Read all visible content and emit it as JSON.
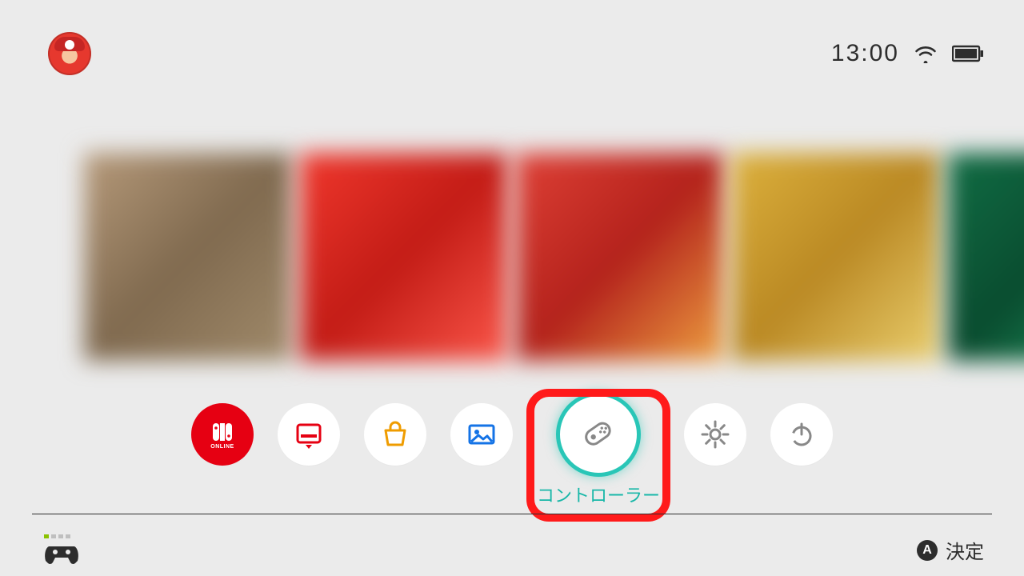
{
  "status": {
    "time": "13:00"
  },
  "dock": {
    "selected_index": 4,
    "items": [
      {
        "name": "online",
        "label": "オンライン"
      },
      {
        "name": "news",
        "label": "ニュース"
      },
      {
        "name": "eshop",
        "label": "ニンテンドーeショップ"
      },
      {
        "name": "album",
        "label": "アルバム"
      },
      {
        "name": "controllers",
        "label": "コントローラー"
      },
      {
        "name": "settings",
        "label": "設定"
      },
      {
        "name": "power",
        "label": "スリープ"
      }
    ]
  },
  "footer": {
    "confirm_button": "A",
    "confirm_label": "決定"
  },
  "tiles": [
    {
      "theme": "#a38a70"
    },
    {
      "theme": "#d9312a"
    },
    {
      "theme": "#c83a2f"
    },
    {
      "theme": "#c7a43a"
    },
    {
      "theme": "#1d6b4b"
    }
  ]
}
